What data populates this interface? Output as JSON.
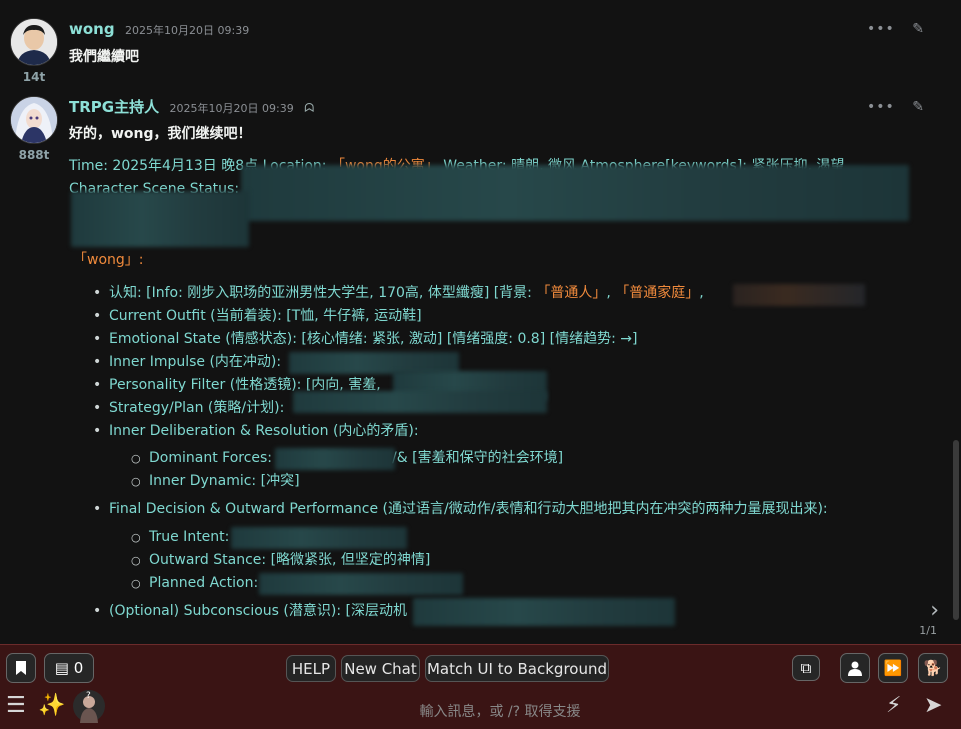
{
  "messages": [
    {
      "name": "wong",
      "timestamp": "2025年10月20日 09:39",
      "tokens": "14t",
      "text": "我們繼續吧"
    },
    {
      "name": "TRPG主持人",
      "timestamp": "2025年10月20日 09:39",
      "tokens": "888t",
      "greeting": "好的，wong，我们继续吧！",
      "line1_a": "Time: 2025年4月13日 晚8点 Location: ",
      "line1_loc": "「wong的公寓」",
      "line1_b": " Weather: 晴朗, 微风 Atmosphere[keywords]: 紧张压抑, 渴望",
      "line2": "Character Scene Status:",
      "section_title": "「wong」:",
      "b1_a": "认知: [Info: 刚步入职场的亚洲男性大学生, 170高, 体型纖瘦] [背景: ",
      "b1_o1": "「普通人」",
      "b1_sep": ", ",
      "b1_o2": "「普通家庭」",
      "b1_end": ",",
      "b2": "Current Outfit (当前着装): [T恤, 牛仔裤, 运动鞋]",
      "b3": "Emotional State (情感状态): [核心情绪: 紧张, 激动] [情绪强度: 0.8] [情绪趋势: →]",
      "b4": "Inner Impulse (内在冲动):",
      "b5": "Personality Filter (性格透镜): [内向, 害羞,",
      "b6": "Strategy/Plan (策略/计划):",
      "b7": "Inner Deliberation & Resolution (内心的矛盾):",
      "b7_s1_a": "Dominant Forces:",
      "b7_s1_b": "/& [害羞和保守的社会环境]",
      "b7_s2": "Inner Dynamic: [冲突]",
      "b8": "Final Decision & Outward Performance (通过语言/微动作/表情和行动大胆地把其内在冲突的两种力量展现出来):",
      "b8_s1": "True Intent:",
      "b8_s2": "Outward Stance: [略微紧张, 但坚定的神情]",
      "b8_s3": "Planned Action:",
      "b9": "(Optional) Subconscious (潜意识): [深层动机"
    }
  ],
  "swipe_counter": "1/1",
  "toolbar": {
    "token_count": "0",
    "help": "HELP",
    "new_chat": "New Chat",
    "match_ui": "Match UI to Background"
  },
  "input": {
    "placeholder": "輸入訊息，或 /? 取得支援"
  },
  "colors": {
    "accent_name": "#8de0d7",
    "bar_bg": "#3a1414",
    "highlight": "#f08a3c"
  }
}
